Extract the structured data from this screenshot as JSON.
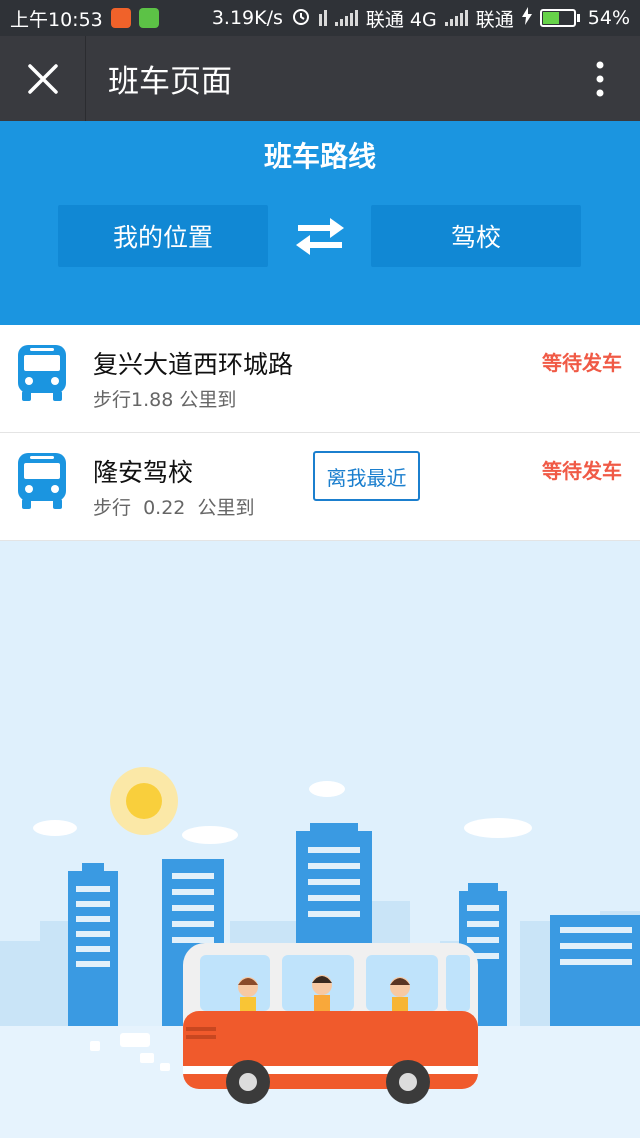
{
  "status_bar": {
    "time": "上午10:53",
    "speed": "3.19K/s",
    "carrier1": "联通 4G",
    "carrier2": "联通",
    "battery_percent": "54%",
    "battery_level": 0.54
  },
  "header": {
    "title": "班车页面",
    "close_icon": "close-icon",
    "menu_icon": "more-vertical-icon"
  },
  "route": {
    "title": "班车路线",
    "from": "我的位置",
    "to": "驾校",
    "swap_icon": "swap-arrows-icon"
  },
  "stops": [
    {
      "name": "复兴大道西环城路",
      "distance": "步行1.88 公里到",
      "status": "等待发车",
      "badge": ""
    },
    {
      "name": "隆安驾校",
      "distance": "步行  0.22  公里到",
      "status": "等待发车",
      "badge": "离我最近"
    }
  ],
  "colors": {
    "header_blue": "#1b95e0",
    "status_red": "#f05a46",
    "badge_blue": "#1b7fce",
    "title_bar": "#393a3f"
  }
}
